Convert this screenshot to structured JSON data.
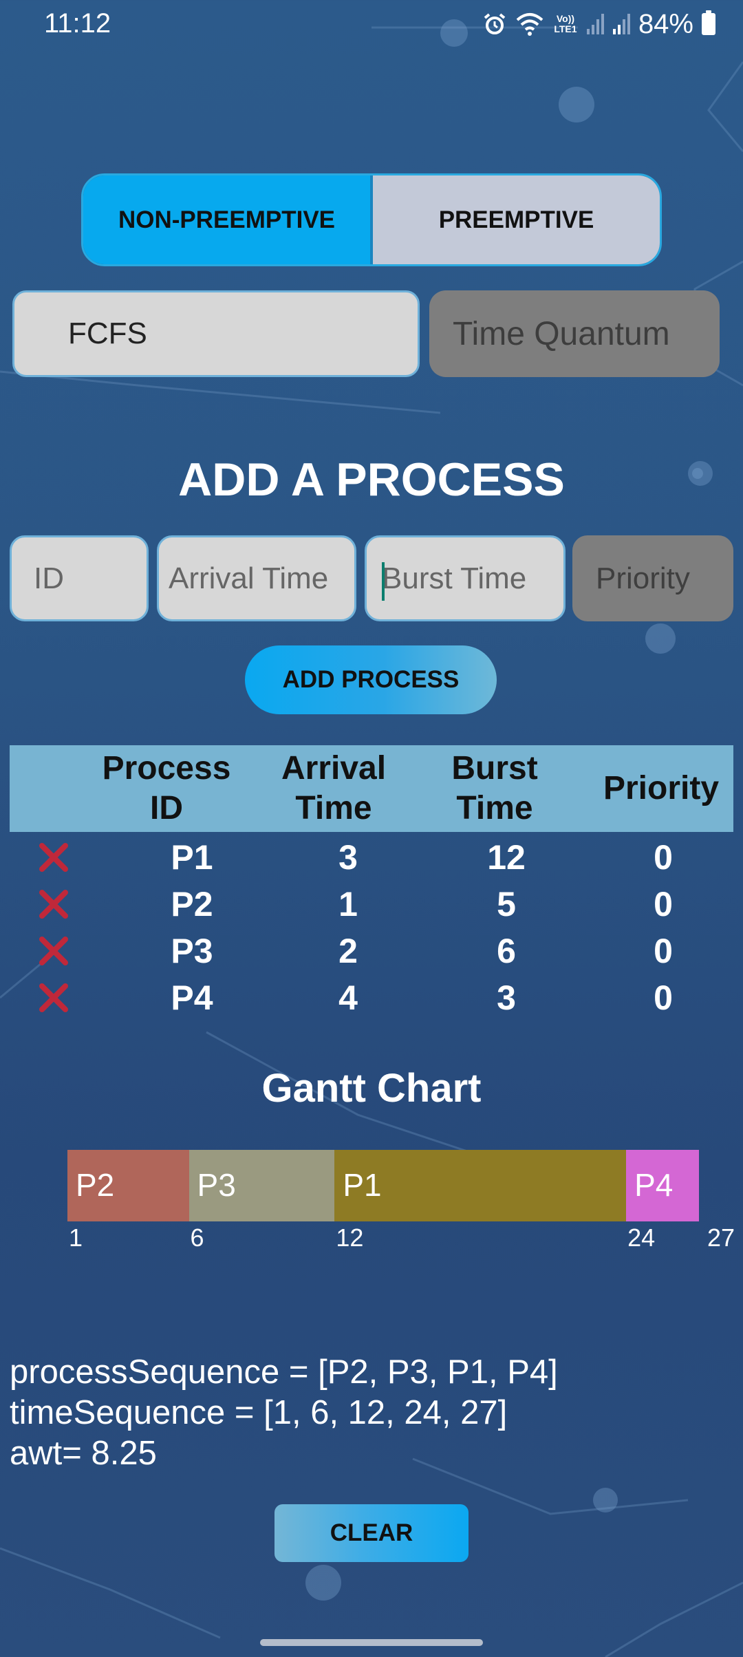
{
  "status_bar": {
    "time": "11:12",
    "battery": "84%",
    "network_label": "Vo)) LTE1",
    "icons": [
      "alarm-icon",
      "wifi-icon",
      "volte-icon",
      "signal-icon",
      "signal-icon",
      "battery-icon"
    ]
  },
  "mode_toggle": {
    "non_preemptive": "NON-PREEMPTIVE",
    "preemptive": "PREEMPTIVE",
    "selected": "NON-PREEMPTIVE"
  },
  "algorithm": {
    "selected": "FCFS",
    "time_quantum_placeholder": "Time Quantum"
  },
  "add_section": {
    "heading": "ADD A PROCESS",
    "id_placeholder": "ID",
    "arrival_placeholder": "Arrival Time",
    "burst_placeholder": "Burst Time",
    "priority_placeholder": "Priority",
    "add_button": "ADD PROCESS"
  },
  "table": {
    "headers": {
      "process_id_line1": "Process",
      "process_id_line2": "ID",
      "arrival_line1": "Arrival",
      "arrival_line2": "Time",
      "burst_line1": "Burst",
      "burst_line2": "Time",
      "priority": "Priority"
    },
    "rows": [
      {
        "id": "P1",
        "arrival": "3",
        "burst": "12",
        "priority": "0"
      },
      {
        "id": "P2",
        "arrival": "1",
        "burst": "5",
        "priority": "0"
      },
      {
        "id": "P3",
        "arrival": "2",
        "burst": "6",
        "priority": "0"
      },
      {
        "id": "P4",
        "arrival": "4",
        "burst": "3",
        "priority": "0"
      }
    ],
    "delete_icon": "close-icon"
  },
  "gantt": {
    "heading": "Gantt Chart",
    "segments": [
      {
        "label": "P2",
        "start": 1,
        "end": 6,
        "color": "#b0665a"
      },
      {
        "label": "P3",
        "start": 6,
        "end": 12,
        "color": "#9a9a80"
      },
      {
        "label": "P1",
        "start": 12,
        "end": 24,
        "color": "#8e7b24"
      },
      {
        "label": "P4",
        "start": 24,
        "end": 27,
        "color": "#d467d4"
      }
    ],
    "ticks": [
      "1",
      "6",
      "12",
      "24",
      "27"
    ]
  },
  "output": {
    "process_sequence": "processSequence = [P2, P3, P1, P4]",
    "time_sequence": "timeSequence = [1, 6, 12, 24, 27]",
    "awt": "awt= 8.25"
  },
  "clear_button": "CLEAR",
  "colors": {
    "accent": "#07a9ee",
    "delete": "#c0283a",
    "table_header": "#78b4d2",
    "input_bg": "#d7d7d7",
    "disabled_bg": "#7e7e7e"
  }
}
